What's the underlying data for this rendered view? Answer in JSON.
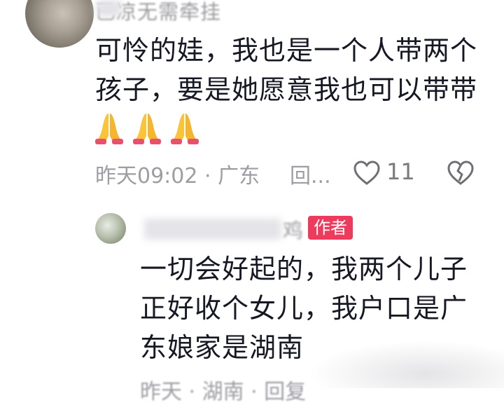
{
  "comment": {
    "username": "已凉无需牵挂",
    "text": "可怜的娃，我也是一个人带两个孩子，要是她愿意我也可以带带",
    "emojis": [
      "pray-icon",
      "pray-icon",
      "pray-icon"
    ],
    "meta": "昨天09:02 · 广东",
    "reply_label": "回...",
    "like_count": "11"
  },
  "reply": {
    "username": "鸡",
    "author_badge": "作者",
    "text": "一切会好起的，我两个儿子正好收个女儿，我户口是广东娘家是湖南",
    "meta": "昨天 · 湖南 · 回复"
  },
  "colors": {
    "badge": "#ee3a5c",
    "secondary_text": "#9d9da3",
    "primary_text": "#161823"
  }
}
